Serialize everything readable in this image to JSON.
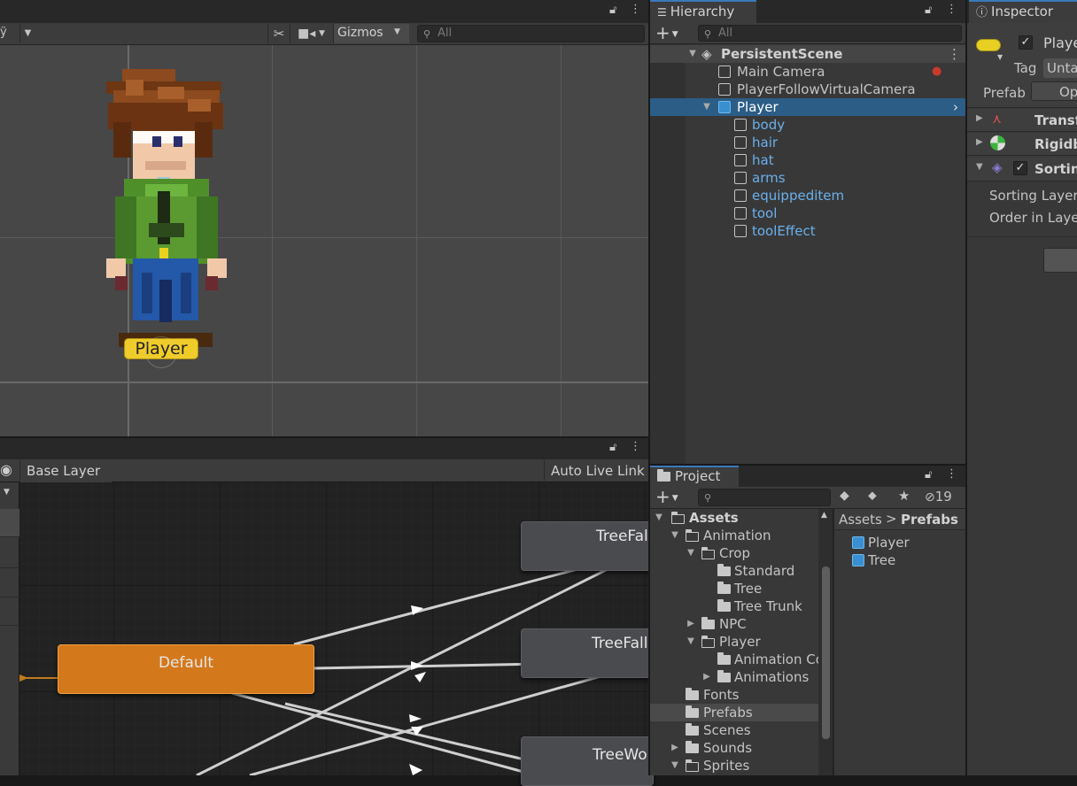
{
  "scene": {
    "toolbar_gizmos": "Gizmos",
    "search_placeholder": "All",
    "player_label": "Player",
    "left_glyph": "ÿ"
  },
  "animator": {
    "breadcrumb": "Base Layer",
    "auto_live_link": "Auto Live Link",
    "nodes": {
      "default": "Default",
      "tree_fall_1": "TreeFal",
      "tree_fall_2": "TreeFall",
      "tree_wo": "TreeWo"
    }
  },
  "hierarchy": {
    "tab_label": "Hierarchy",
    "search_placeholder": "All",
    "add_label": "+",
    "scene_name": "PersistentScene",
    "items": [
      {
        "label": "Main Camera"
      },
      {
        "label": "PlayerFollowVirtualCamera"
      },
      {
        "label": "Player"
      }
    ],
    "player_children": [
      "body",
      "hair",
      "hat",
      "arms",
      "equippeditem",
      "tool",
      "toolEffect"
    ]
  },
  "project": {
    "tab_label": "Project",
    "hidden_count": "19",
    "tree": [
      {
        "label": "Assets"
      },
      {
        "label": "Animation"
      },
      {
        "label": "Crop"
      },
      {
        "label": "Standard"
      },
      {
        "label": "Tree"
      },
      {
        "label": "Tree Trunk"
      },
      {
        "label": "NPC"
      },
      {
        "label": "Player"
      },
      {
        "label": "Animation Co"
      },
      {
        "label": "Animations"
      },
      {
        "label": "Fonts"
      },
      {
        "label": "Prefabs"
      },
      {
        "label": "Scenes"
      },
      {
        "label": "Sounds"
      },
      {
        "label": "Sprites"
      }
    ],
    "breadcrumb_root": "Assets",
    "breadcrumb_current": "Prefabs",
    "assets": [
      "Player",
      "Tree"
    ]
  },
  "inspector": {
    "tab_label": "Inspector",
    "object_name": "Playe",
    "tag_label": "Tag",
    "tag_value": "Unta",
    "prefab_label": "Prefab",
    "prefab_button": "Op",
    "components": [
      "Transf",
      "Rigidb",
      "Sorting"
    ],
    "sorting_layer_label": "Sorting Layer",
    "order_in_layer_label": "Order in Layer"
  },
  "colors": {
    "selection": "#2c5d87",
    "node_default": "#d4781c",
    "node_state": "#4a4b4e",
    "link_text": "#6ab0ec"
  }
}
